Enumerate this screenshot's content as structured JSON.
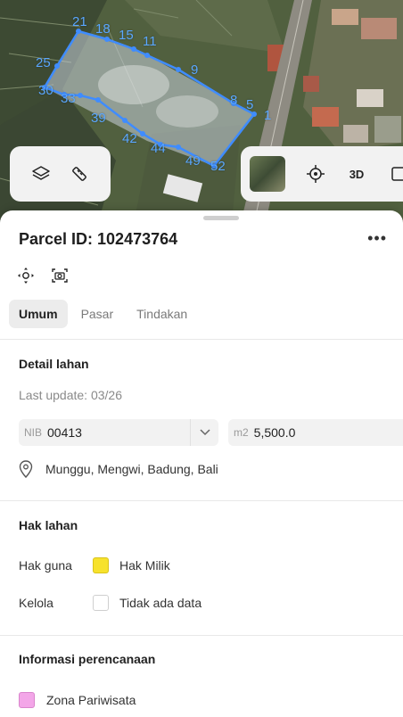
{
  "map": {
    "markers": [
      "21",
      "18",
      "15",
      "11",
      "25",
      "9",
      "30",
      "33",
      "8",
      "5",
      "1",
      "39",
      "42",
      "44",
      "49",
      "52"
    ],
    "layers_icon": "layers-icon",
    "measure_icon": "ruler-icon",
    "locate_icon": "crosshair-icon",
    "mode_3d_label": "3D",
    "parcel_color": "#3f8cff"
  },
  "sheet": {
    "title": "Parcel ID: 102473764",
    "more_label": "•••",
    "tools": [
      "focus-parcel-icon",
      "camera-icon"
    ],
    "tabs": [
      {
        "label": "Umum",
        "active": true
      },
      {
        "label": "Pasar",
        "active": false
      },
      {
        "label": "Tindakan",
        "active": false
      }
    ]
  },
  "detail": {
    "title": "Detail lahan",
    "last_update": "Last update: 03/26",
    "nib_prefix": "NIB",
    "nib_value": "00413",
    "area_prefix": "m2",
    "area_value": "5,500.0",
    "address": "Munggu, Mengwi, Badung, Bali"
  },
  "rights": {
    "title": "Hak lahan",
    "use_label": "Hak guna",
    "use_value": "Hak Milik",
    "use_color": "#f7e22c",
    "manage_label": "Kelola",
    "manage_value": "Tidak ada data",
    "manage_color": "#ffffff"
  },
  "planning": {
    "title": "Informasi perencanaan",
    "zone_value": "Zona Pariwisata",
    "zone_color": "#f3a6e8"
  }
}
